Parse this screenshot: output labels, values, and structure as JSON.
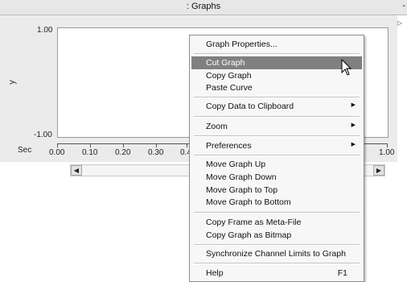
{
  "window": {
    "title": ": Graphs",
    "title_right_glyph": "-",
    "collapse_glyph": "▷"
  },
  "plot": {
    "y_axis_label": "y",
    "y_ticks": [
      "1.00",
      "-1.00"
    ],
    "x_unit_label": "Sec",
    "x_ticks": [
      "0.00",
      "0.10",
      "0.20",
      "0.30",
      "0.4",
      "1.00"
    ]
  },
  "scrollbar": {
    "left_glyph": "◀",
    "right_glyph": "▶"
  },
  "context_menu": {
    "items": [
      {
        "label": "Graph Properties..."
      },
      {
        "label": "Cut Graph",
        "highlighted": true
      },
      {
        "label": "Copy Graph"
      },
      {
        "label": "Paste Curve"
      },
      {
        "label": "Copy Data to Clipboard",
        "submenu_glyph": "▶"
      },
      {
        "label": "Zoom",
        "submenu_glyph": "▶"
      },
      {
        "label": "Preferences",
        "submenu_glyph": "▶"
      },
      {
        "label": "Move Graph Up"
      },
      {
        "label": "Move Graph Down"
      },
      {
        "label": "Move Graph to Top"
      },
      {
        "label": "Move Graph to Bottom"
      },
      {
        "label": "Copy Frame as Meta-File"
      },
      {
        "label": "Copy Graph as Bitmap"
      },
      {
        "label": "Synchronize Channel Limits to Graph"
      },
      {
        "label": "Help",
        "shortcut": "F1"
      }
    ]
  },
  "colors": {
    "highlight": "#808080",
    "menu_bg": "#f7f7f7",
    "panel_bg": "#ebebeb"
  }
}
